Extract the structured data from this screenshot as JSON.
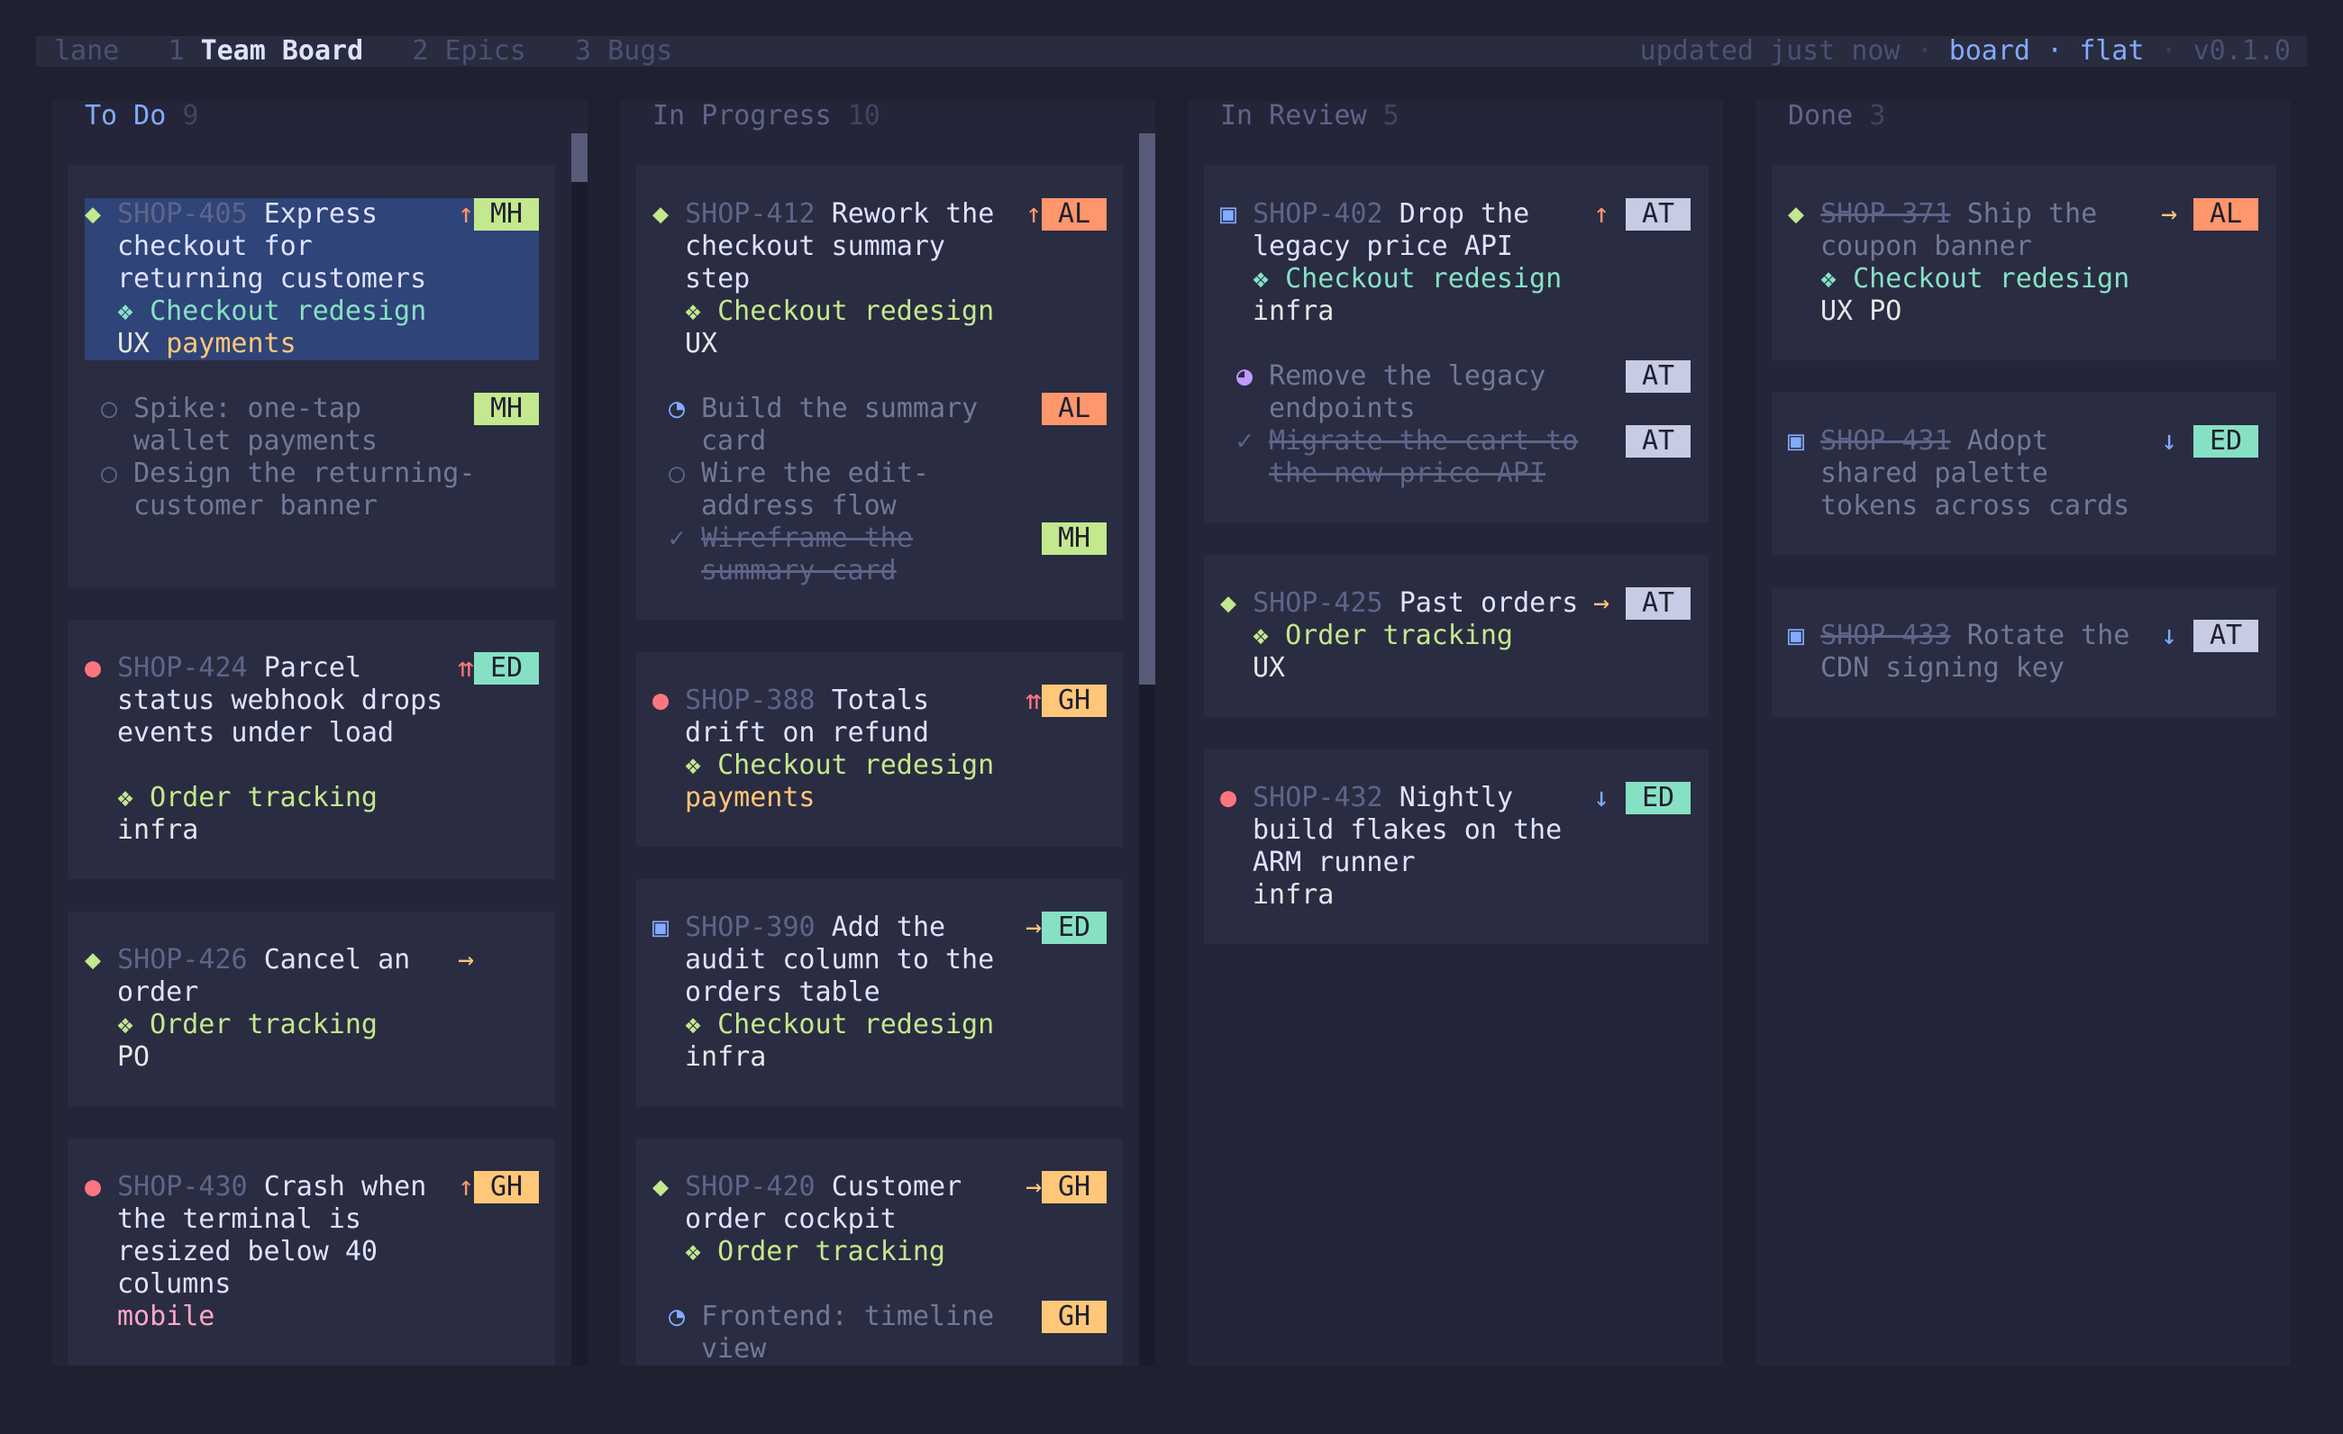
{
  "top_bar": {
    "app": "lane",
    "tabs": [
      {
        "num": "1",
        "label": "Team Board"
      },
      {
        "num": "2",
        "label": "Epics"
      },
      {
        "num": "3",
        "label": "Bugs"
      }
    ],
    "status": "updated just now",
    "sep": "·",
    "view_mode": "board",
    "layout_mode": "flat",
    "version": "v0.1.0"
  },
  "columns": [
    {
      "title": "To Do",
      "count": "9"
    },
    {
      "title": "In Progress",
      "count": "10"
    },
    {
      "title": "In Review",
      "count": "5"
    },
    {
      "title": "Done",
      "count": "3"
    }
  ],
  "cards": {
    "c405": {
      "icon": "◆",
      "key": "SHOP-405",
      "t1": "Express",
      "t2": "checkout for",
      "t3": "returning customers",
      "prio": "↑",
      "assignee": "MH",
      "epic": "❖ Checkout redesign",
      "label1": "UX",
      "label2": "payments",
      "sub1": {
        "icon": "○",
        "l1": "Spike: one-tap",
        "l2": "wallet payments",
        "assignee": "MH"
      },
      "sub2": {
        "icon": "○",
        "l1": "Design the returning-",
        "l2": "customer banner"
      }
    },
    "c424": {
      "icon": "●",
      "key": "SHOP-424",
      "t1": "Parcel",
      "t2": "status webhook drops",
      "t3": "events under load",
      "prio": "⇈",
      "assignee": "ED",
      "epic": "❖ Order tracking",
      "label1": "infra"
    },
    "c426": {
      "icon": "◆",
      "key": "SHOP-426",
      "t1": "Cancel an",
      "t2": "order",
      "prio": "→",
      "epic": "❖ Order tracking",
      "label1": "PO"
    },
    "c430": {
      "icon": "●",
      "key": "SHOP-430",
      "t1": "Crash when",
      "t2": "the terminal is",
      "t3": "resized below 40",
      "t4": "columns",
      "prio": "↑",
      "assignee": "GH",
      "label1": "mobile"
    },
    "c412": {
      "icon": "◆",
      "key": "SHOP-412",
      "t1": "Rework the",
      "t2": "checkout summary",
      "t3": "step",
      "prio": "↑",
      "assignee": "AL",
      "epic": "❖ Checkout redesign",
      "label1": "UX",
      "sub1": {
        "icon": "◔",
        "l1": "Build the summary",
        "l2": "card",
        "assignee": "AL"
      },
      "sub2": {
        "icon": "○",
        "l1": "Wire the edit-",
        "l2": "address flow"
      },
      "sub3": {
        "icon": "✓",
        "l1": "Wireframe the",
        "l2": "summary card",
        "assignee": "MH"
      }
    },
    "c388": {
      "icon": "●",
      "key": "SHOP-388",
      "t1": "Totals",
      "t2": "drift on refund",
      "prio": "⇈",
      "assignee": "GH",
      "epic": "❖ Checkout redesign",
      "label1": "payments"
    },
    "c390": {
      "icon": "▣",
      "key": "SHOP-390",
      "t1": "Add the",
      "t2": "audit column to the",
      "t3": "orders table",
      "prio": "→",
      "assignee": "ED",
      "epic": "❖ Checkout redesign",
      "label1": "infra"
    },
    "c420": {
      "icon": "◆",
      "key": "SHOP-420",
      "t1": "Customer",
      "t2": "order cockpit",
      "prio": "→",
      "assignee": "GH",
      "epic": "❖ Order tracking",
      "sub1": {
        "icon": "◔",
        "l1": "Frontend: timeline",
        "l2": "view",
        "assignee": "GH"
      }
    },
    "c402": {
      "icon": "▣",
      "key": "SHOP-402",
      "t1": "Drop the",
      "t2": "legacy price API",
      "prio": "↑",
      "assignee": "AT",
      "epic": "❖ Checkout redesign",
      "label1": "infra",
      "sub1": {
        "icon": "◕",
        "l1": "Remove the legacy",
        "l2": "endpoints",
        "assignee": "AT"
      },
      "sub2": {
        "icon": "✓",
        "l1": "Migrate the cart to",
        "l2": "the new price API",
        "assignee": "AT"
      }
    },
    "c425": {
      "icon": "◆",
      "key": "SHOP-425",
      "t1": "Past orders",
      "prio": "→",
      "assignee": "AT",
      "epic": "❖ Order tracking",
      "label1": "UX"
    },
    "c432": {
      "icon": "●",
      "key": "SHOP-432",
      "t1": "Nightly",
      "t2": "build flakes on the",
      "t3": "ARM runner",
      "prio": "↓",
      "assignee": "ED",
      "label1": "infra"
    },
    "c371": {
      "icon": "◆",
      "key": "SHOP-371",
      "t1": "Ship the",
      "t2": "coupon banner",
      "prio": "→",
      "assignee": "AL",
      "epic": "❖ Checkout redesign",
      "label1": "UX",
      "label2": "PO"
    },
    "c431": {
      "icon": "▣",
      "key": "SHOP-431",
      "t1": "Adopt",
      "t2": "shared palette",
      "t3": "tokens across cards",
      "prio": "↓",
      "assignee": "ED"
    },
    "c433": {
      "icon": "▣",
      "key": "SHOP-433",
      "t1": "Rotate the",
      "t2": "CDN signing key",
      "prio": "↓",
      "assignee": "AT"
    }
  },
  "colors": {
    "background": "#1f2030",
    "column": "#242538",
    "card": "#2a2c42",
    "selection": "#2f4478",
    "accent": "#82aaff"
  }
}
